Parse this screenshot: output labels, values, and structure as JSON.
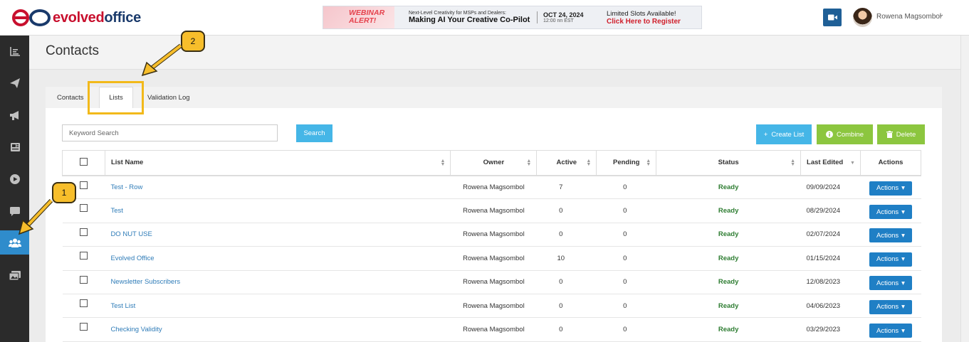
{
  "header": {
    "logo_part1": "evolved",
    "logo_part2": "office",
    "banner": {
      "tag": "WEBINAR ALERT!",
      "subtitle": "Next-Level Creativity for MSPs and Dealers:",
      "headline": "Making AI Your Creative Co-Pilot",
      "date": "OCT 24, 2024",
      "time": "12:00 nn EST",
      "cta_line1": "Limited Slots Available!",
      "cta_line2": "Click Here to Register"
    },
    "user_name": "Rowena Magsombol"
  },
  "sidebar": {
    "items": [
      {
        "icon": "reports-icon"
      },
      {
        "icon": "send-icon"
      },
      {
        "icon": "megaphone-icon"
      },
      {
        "icon": "newspaper-icon"
      },
      {
        "icon": "play-icon"
      },
      {
        "icon": "chat-icon"
      },
      {
        "icon": "contacts-users-icon",
        "active": true
      },
      {
        "icon": "media-gallery-icon"
      }
    ]
  },
  "page": {
    "title": "Contacts",
    "tabs": [
      "Contacts",
      "Lists",
      "Validation Log"
    ],
    "active_tab": "Lists"
  },
  "toolbar": {
    "search_placeholder": "Keyword Search",
    "search_label": "Search",
    "create_label": "Create List",
    "combine_label": "Combine",
    "delete_label": "Delete"
  },
  "table": {
    "columns": [
      "List Name",
      "Owner",
      "Active",
      "Pending",
      "Status",
      "Last Edited",
      "Actions"
    ],
    "rows": [
      {
        "name": "Test - Row",
        "owner": "Rowena Magsombol",
        "active": "7",
        "pending": "0",
        "status": "Ready",
        "edited": "09/09/2024",
        "action": "Actions"
      },
      {
        "name": "Test",
        "owner": "Rowena Magsombol",
        "active": "0",
        "pending": "0",
        "status": "Ready",
        "edited": "08/29/2024",
        "action": "Actions"
      },
      {
        "name": "DO NUT USE",
        "owner": "Rowena Magsombol",
        "active": "0",
        "pending": "0",
        "status": "Ready",
        "edited": "02/07/2024",
        "action": "Actions"
      },
      {
        "name": "Evolved Office",
        "owner": "Rowena Magsombol",
        "active": "10",
        "pending": "0",
        "status": "Ready",
        "edited": "01/15/2024",
        "action": "Actions"
      },
      {
        "name": "Newsletter Subscribers",
        "owner": "Rowena Magsombol",
        "active": "0",
        "pending": "0",
        "status": "Ready",
        "edited": "12/08/2023",
        "action": "Actions"
      },
      {
        "name": "Test List",
        "owner": "Rowena Magsombol",
        "active": "0",
        "pending": "0",
        "status": "Ready",
        "edited": "04/06/2023",
        "action": "Actions"
      },
      {
        "name": "Checking Validity",
        "owner": "Rowena Magsombol",
        "active": "0",
        "pending": "0",
        "status": "Ready",
        "edited": "03/29/2023",
        "action": "Actions"
      }
    ]
  },
  "annotations": {
    "badge1": "1",
    "badge2": "2",
    "color": "#f7be2b"
  }
}
